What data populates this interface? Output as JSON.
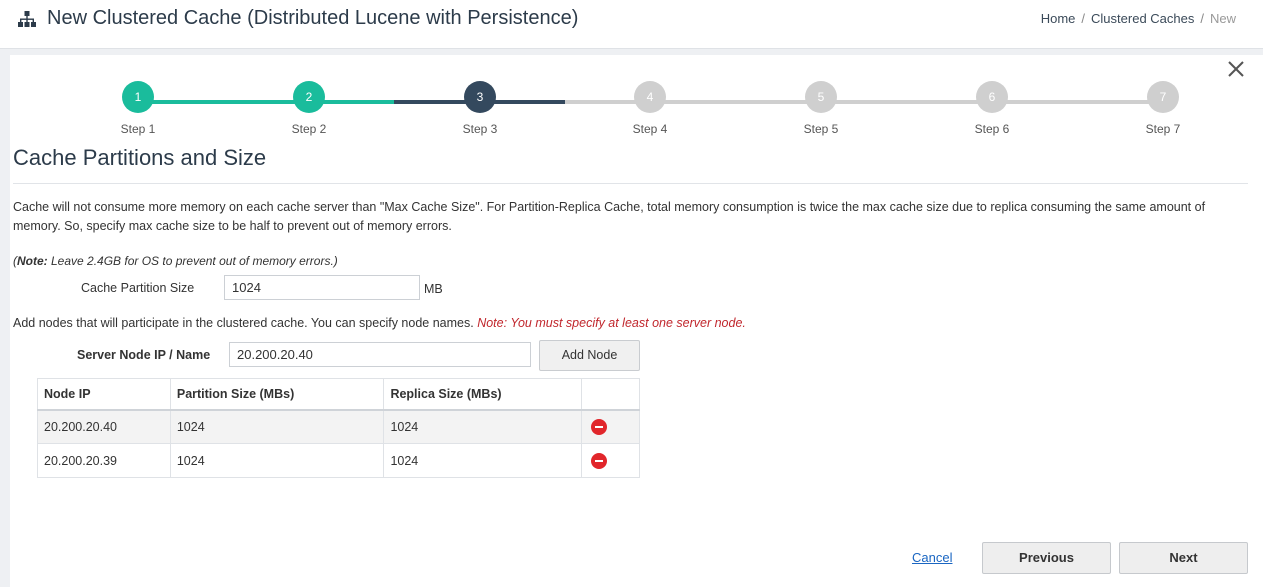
{
  "header": {
    "title": "New Clustered Cache (Distributed Lucene with Persistence)",
    "icon": "sitemap-icon",
    "breadcrumb": [
      "Home",
      "Clustered Caches",
      "New"
    ]
  },
  "wizard": {
    "steps": [
      {
        "number": "1",
        "label": "Step 1",
        "state": "completed"
      },
      {
        "number": "2",
        "label": "Step 2",
        "state": "completed"
      },
      {
        "number": "3",
        "label": "Step 3",
        "state": "current"
      },
      {
        "number": "4",
        "label": "Step 4",
        "state": "pending"
      },
      {
        "number": "5",
        "label": "Step 5",
        "state": "pending"
      },
      {
        "number": "6",
        "label": "Step 6",
        "state": "pending"
      },
      {
        "number": "7",
        "label": "Step 7",
        "state": "pending"
      }
    ],
    "colors": {
      "completed": "#1abc9c",
      "current": "#34495e",
      "pending": "#cfcfcf"
    }
  },
  "section": {
    "heading": "Cache Partitions and Size",
    "description": "Cache will not consume more memory on each cache server than \"Max Cache Size\". For Partition-Replica Cache, total memory consumption is twice the max cache size due to replica consuming the same amount of memory. So, specify max cache size to be half to prevent out of memory errors.",
    "note_prefix": "(",
    "note_bold": "Note:",
    "note_text": " Leave 2.4GB for OS to prevent out of memory errors.)"
  },
  "partition": {
    "label": "Cache Partition Size",
    "value": "1024",
    "unit": "MB"
  },
  "nodes": {
    "description": "Add nodes that will participate in the clustered cache. You can specify node names.",
    "warning": "Note: You must specify at least one server node.",
    "server_label": "Server Node IP / Name",
    "server_value": "20.200.20.40",
    "add_button": "Add Node",
    "columns": [
      "Node IP",
      "Partition Size (MBs)",
      "Replica Size (MBs)"
    ],
    "rows": [
      {
        "ip": "20.200.20.40",
        "partition": "1024",
        "replica": "1024"
      },
      {
        "ip": "20.200.20.39",
        "partition": "1024",
        "replica": "1024"
      }
    ]
  },
  "footer": {
    "cancel": "Cancel",
    "previous": "Previous",
    "next": "Next"
  }
}
